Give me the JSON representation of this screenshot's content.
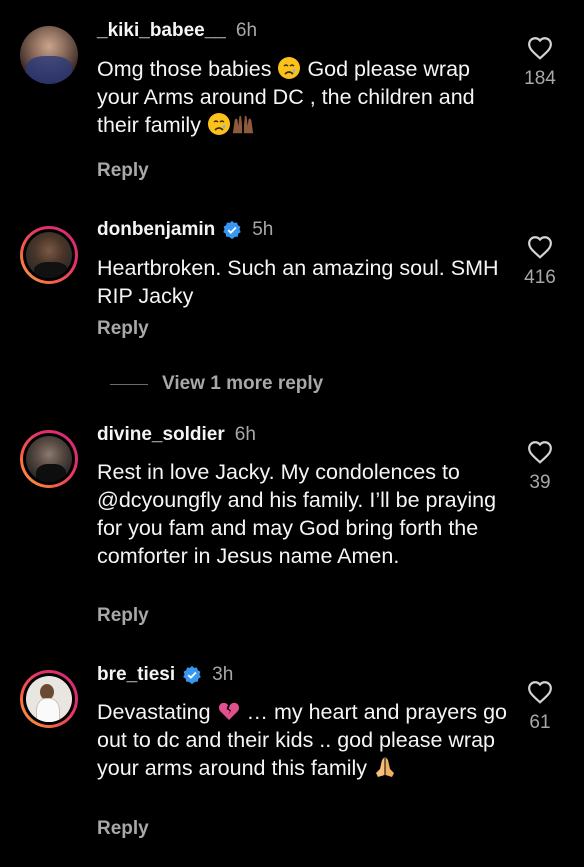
{
  "comments": [
    {
      "username": "_kiki_babee__",
      "verified": false,
      "time": "6h",
      "text_parts": [
        "Omg those babies ",
        " God please wrap your Arms around DC , the children and their family "
      ],
      "likes": "184",
      "reply_label": "Reply"
    },
    {
      "username": "donbenjamin",
      "verified": true,
      "time": "5h",
      "text_parts": [
        "Heartbroken. Such an amazing soul. SMH RIP Jacky"
      ],
      "likes": "416",
      "reply_label": "Reply"
    },
    {
      "username": "divine_soldier",
      "verified": false,
      "time": "6h",
      "text_parts": [
        "Rest in love Jacky. My condolences to @dcyoungfly and his family. I’ll be praying for you fam and may God bring forth the comforter in Jesus name Amen."
      ],
      "likes": "39",
      "reply_label": "Reply"
    },
    {
      "username": "bre_tiesi",
      "verified": true,
      "time": "3h",
      "text_parts": [
        "Devastating ",
        " … my heart and prayers go out to dc and their kids .. god please wrap your arms around this family "
      ],
      "likes": "61",
      "reply_label": "Reply"
    }
  ],
  "view_more": "View 1 more reply",
  "colors": {
    "background": "#000000",
    "text": "#f5f5f5",
    "muted": "#a8a8a8",
    "verified": "#3897f0"
  },
  "icons": [
    "heart-icon",
    "verified-icon",
    "crying-face-emoji",
    "raised-hands-emoji",
    "broken-heart-emoji",
    "praying-hands-emoji"
  ]
}
